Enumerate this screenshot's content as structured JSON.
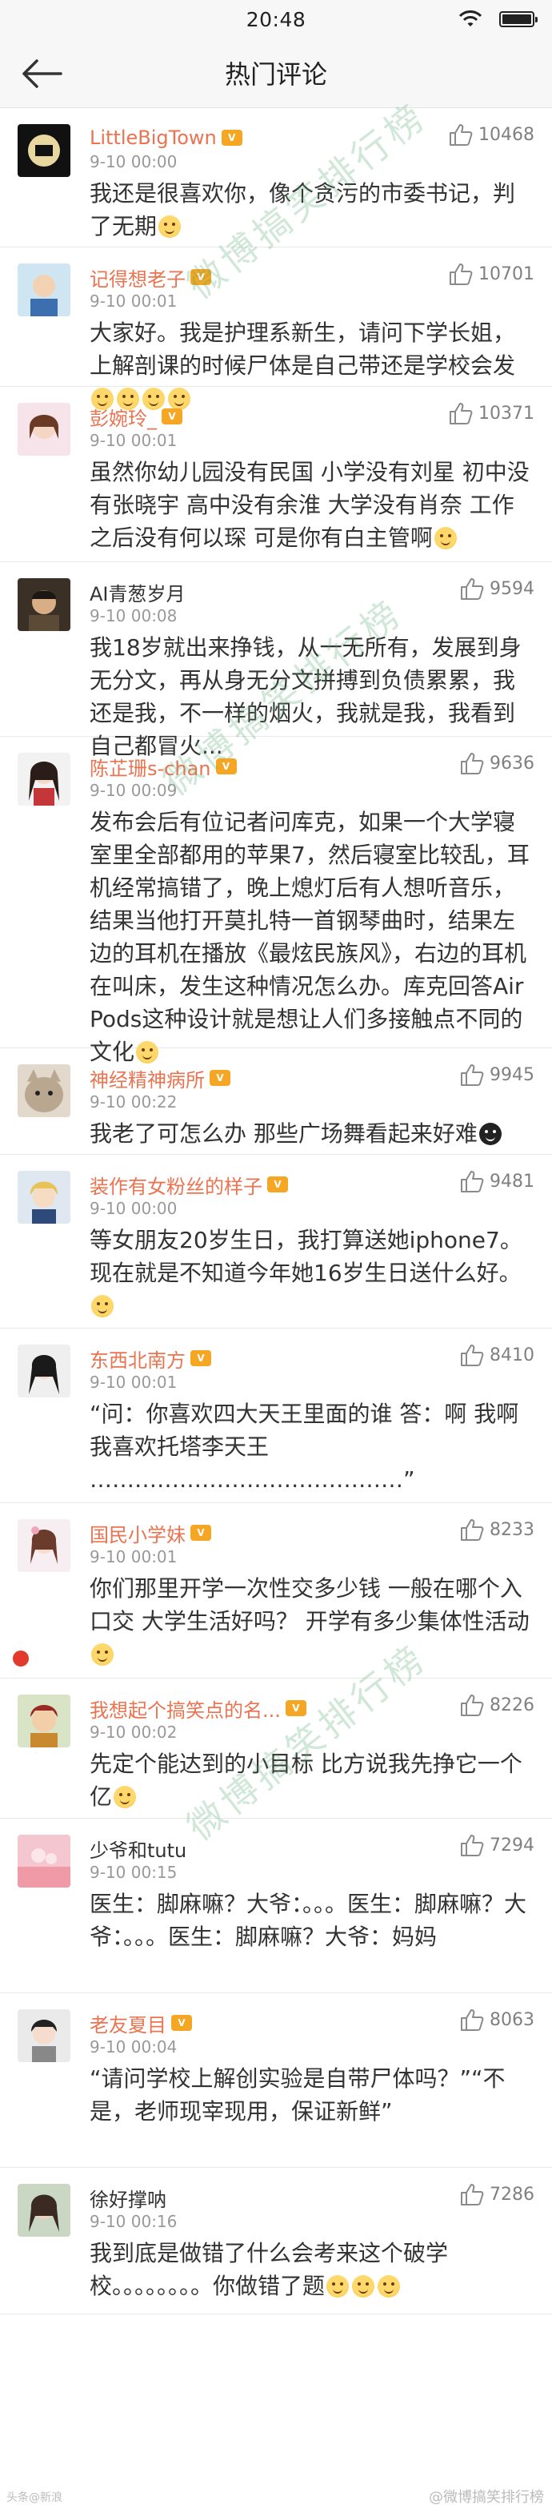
{
  "status_bar": {
    "time": "20:48"
  },
  "nav": {
    "title": "热门评论"
  },
  "comments": [
    {
      "name": "LittleBigTown",
      "likes": "10468",
      "time": "9-10 00:00",
      "text": "我还是很喜欢你，像个贪污的市委书记，判了无期"
    },
    {
      "name": "记得想老子",
      "likes": "10701",
      "time": "9-10 00:01",
      "text": "大家好。我是护理系新生，请问下学长姐，上解剖课的时候尸体是自己带还是学校会发"
    },
    {
      "name": "彭婉玲_",
      "likes": "10371",
      "time": "9-10 00:01",
      "text": "虽然你幼儿园没有民国 小学没有刘星 初中没有张晓宇 高中没有余淮 大学没有肖奈 工作之后没有何以琛 可是你有白主管啊"
    },
    {
      "name": "AI青葱岁月",
      "likes": "9594",
      "time": "9-10 00:08",
      "text": "我18岁就出来挣钱，从一无所有，发展到身无分文，再从身无分文拼搏到负债累累，我还是我，不一样的烟火，我就是我，我看到自己都冒火..."
    },
    {
      "name": "陈芷珊s-chan",
      "likes": "9636",
      "time": "9-10 00:09",
      "text": "发布会后有位记者问库克，如果一个大学寝室里全部都用的苹果7，然后寝室比较乱，耳机经常搞错了，晚上熄灯后有人想听音乐，结果当他打开莫扎特一首钢琴曲时，结果左边的耳机在播放《最炫民族风》，右边的耳机在叫床，发生这种情况怎么办。库克回答AirPods这种设计就是想让人们多接触点不同的文化"
    },
    {
      "name": "神经精神病所",
      "likes": "9945",
      "time": "9-10 00:22",
      "text": "我老了可怎么办 那些广场舞看起来好难"
    },
    {
      "name": "装作有女粉丝的样子",
      "likes": "9481",
      "time": "9-10 00:00",
      "text": "等女朋友20岁生日，我打算送她iphone7。现在就是不知道今年她16岁生日送什么好。"
    },
    {
      "name": "东西北南方",
      "likes": "8410",
      "time": "9-10 00:01",
      "text": "“问：你喜欢四大天王里面的谁  答：啊 我啊 我喜欢托塔李天王 ……………………………………”"
    },
    {
      "name": "国民小学妹",
      "likes": "8233",
      "time": "9-10 00:01",
      "text": "你们那里开学一次性交多少钱  一般在哪个入口交  大学生活好吗？  开学有多少集体性活动"
    },
    {
      "name": "我想起个搞笑点的名...",
      "likes": "8226",
      "time": "9-10 00:02",
      "text": "先定个能达到的小目标 比方说我先挣它一个亿"
    },
    {
      "name": "少爷和tutu",
      "likes": "7294",
      "time": "9-10 00:15",
      "text": "医生：脚麻嘛？大爷：。。。医生：脚麻嘛？大爷：。。。医生：脚麻嘛？大爷：妈妈"
    },
    {
      "name": "老友夏目",
      "likes": "8063",
      "time": "9-10 00:04",
      "text": "“请问学校上解创实验是自带尸体吗？”“不是，老师现宰现用，保证新鲜”"
    },
    {
      "name": "徐好撑呐",
      "likes": "7286",
      "time": "9-10 00:16",
      "text": "我到底是做错了什么会考来这个破学校。。。。。。。。你做错了题"
    }
  ],
  "footer": {
    "left": "头条@新浪",
    "right": "@微博搞笑排行榜"
  },
  "watermark": {
    "text": "微博搞笑排行榜"
  }
}
